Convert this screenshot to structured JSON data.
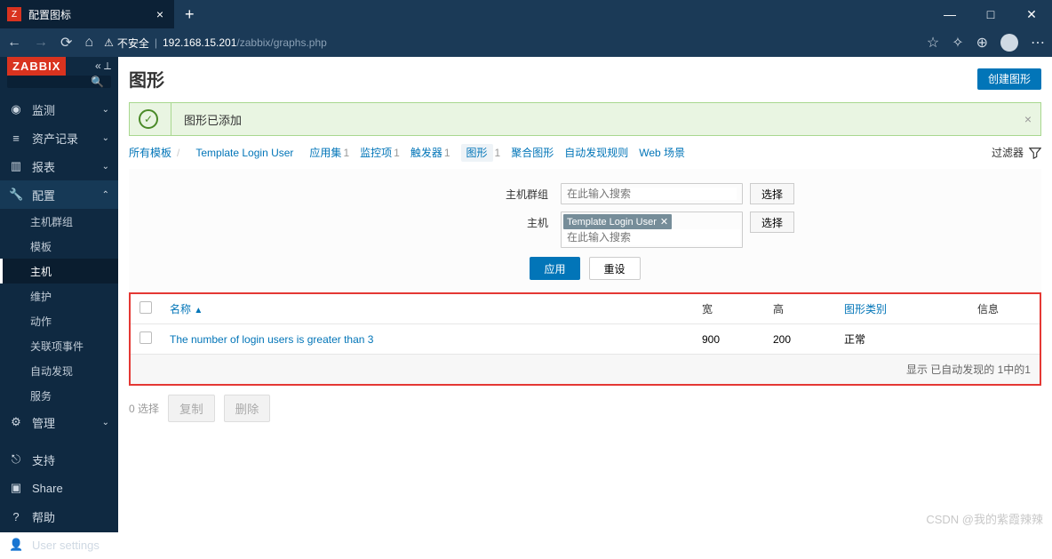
{
  "browser": {
    "tab_title": "配置图标",
    "insecure_label": "不安全",
    "url_host": "192.168.15.201",
    "url_path": "/zabbix/graphs.php"
  },
  "window_controls": {
    "min": "—",
    "max": "□",
    "close": "✕"
  },
  "sidebar": {
    "logo": "ZABBIX",
    "items": [
      {
        "icon": "◉",
        "label": "监测",
        "arrow": "⌄"
      },
      {
        "icon": "≡",
        "label": "资产记录",
        "arrow": "⌄"
      },
      {
        "icon": "▥",
        "label": "报表",
        "arrow": "⌄"
      },
      {
        "icon": "🔧",
        "label": "配置",
        "arrow": "⌃",
        "expanded": true,
        "submenu": [
          "主机群组",
          "模板",
          "主机",
          "维护",
          "动作",
          "关联项事件",
          "自动发现",
          "服务"
        ],
        "active_index": 2
      },
      {
        "icon": "⚙",
        "label": "管理",
        "arrow": "⌄"
      }
    ],
    "bottom": [
      {
        "icon": "⎋",
        "label": "支持"
      },
      {
        "icon": "▣",
        "label": "Share"
      },
      {
        "icon": "?",
        "label": "帮助"
      },
      {
        "icon": "👤",
        "label": "User settings"
      }
    ]
  },
  "page": {
    "title": "图形",
    "create_button": "创建图形"
  },
  "success": {
    "text": "图形已添加"
  },
  "breadcrumbs": {
    "all_templates": "所有模板",
    "template": "Template Login User",
    "links": [
      {
        "label": "应用集",
        "count": "1"
      },
      {
        "label": "监控项",
        "count": "1"
      },
      {
        "label": "触发器",
        "count": "1"
      },
      {
        "label": "图形",
        "count": "1",
        "active": true
      },
      {
        "label": "聚合图形",
        "count": ""
      },
      {
        "label": "自动发现规则",
        "count": ""
      },
      {
        "label": "Web 场景",
        "count": ""
      }
    ],
    "filter_label": "过滤器"
  },
  "filter": {
    "hostgroup_label": "主机群组",
    "host_label": "主机",
    "placeholder": "在此输入搜索",
    "selected_host": "Template Login User",
    "select_button": "选择",
    "apply": "应用",
    "reset": "重设"
  },
  "table": {
    "columns": {
      "name": "名称",
      "width": "宽",
      "height": "高",
      "type": "图形类别",
      "info": "信息"
    },
    "rows": [
      {
        "name": "The number of login users is greater than 3",
        "width": "900",
        "height": "200",
        "type": "正常",
        "info": ""
      }
    ],
    "footer": "显示 已自动发现的 1中的1"
  },
  "bulk": {
    "selected": "0 选择",
    "copy": "复制",
    "delete": "删除"
  },
  "watermark": "CSDN @我的紫霞辣辣"
}
